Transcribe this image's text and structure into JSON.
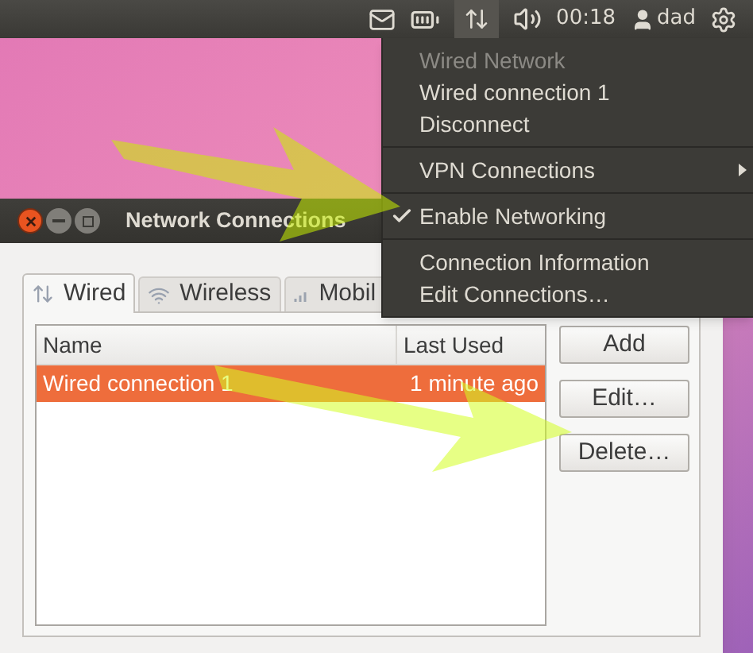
{
  "top_panel": {
    "clock": "00:18",
    "user": "dad"
  },
  "network_menu": {
    "items": [
      {
        "kind": "header",
        "label": "Wired Network"
      },
      {
        "kind": "item",
        "label": "Wired connection 1"
      },
      {
        "kind": "item",
        "label": "Disconnect"
      },
      {
        "kind": "separator"
      },
      {
        "kind": "submenu",
        "label": "VPN Connections"
      },
      {
        "kind": "separator"
      },
      {
        "kind": "check",
        "label": "Enable Networking",
        "checked": true
      },
      {
        "kind": "separator"
      },
      {
        "kind": "item",
        "label": "Connection Information"
      },
      {
        "kind": "item",
        "label": "Edit Connections…"
      }
    ]
  },
  "window": {
    "title": "Network Connections",
    "tabs": [
      {
        "label": "Wired",
        "selected": true,
        "kind": "wired"
      },
      {
        "label": "Wireless",
        "selected": false,
        "kind": "wireless"
      },
      {
        "label": "Mobil",
        "selected": false,
        "kind": "mobile"
      }
    ],
    "table": {
      "columns": [
        "Name",
        "Last Used"
      ],
      "rows": [
        {
          "name": "Wired connection 1",
          "last_used": "1 minute ago",
          "selected": true
        }
      ]
    },
    "buttons": [
      "Add",
      "Edit…",
      "Delete…"
    ]
  }
}
